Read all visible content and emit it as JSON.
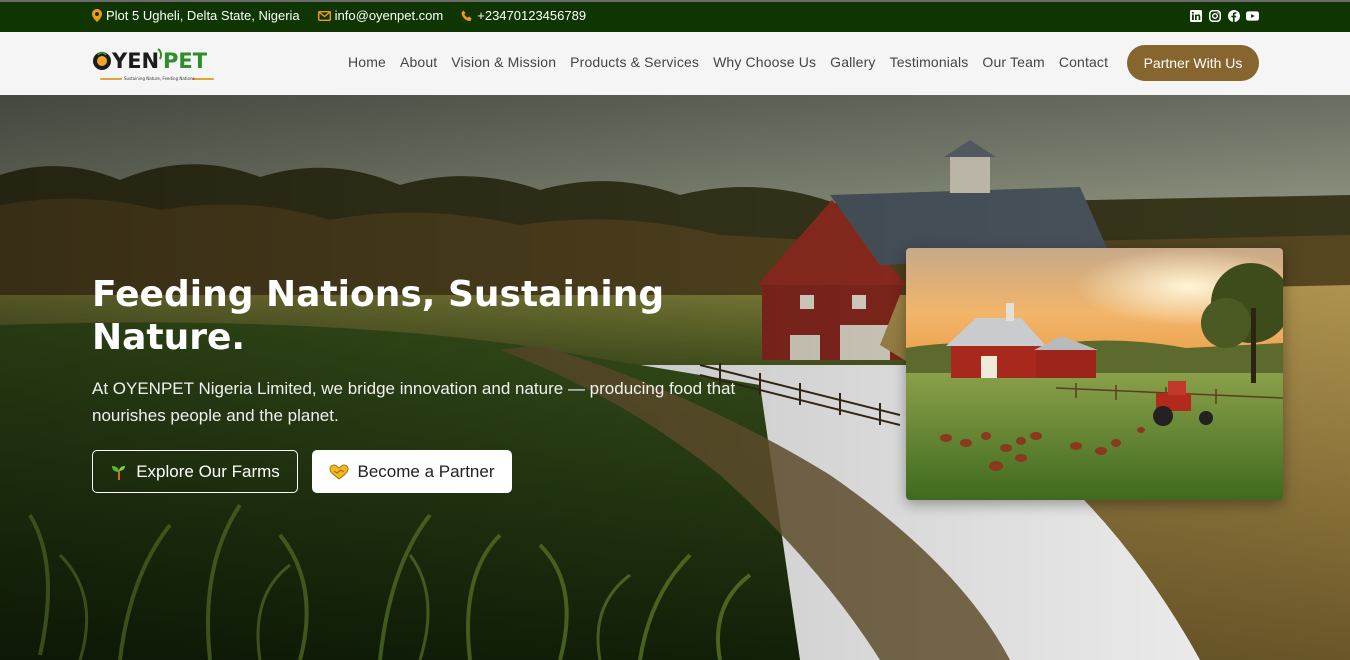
{
  "topbar": {
    "address": "Plot 5 Ugheli, Delta State, Nigeria",
    "email": "info@oyenpet.com",
    "phone": "+23470123456789",
    "social": [
      "linkedin-icon",
      "instagram-icon",
      "facebook-icon",
      "youtube-icon"
    ]
  },
  "header": {
    "logo_text": "OYENPET",
    "logo_tagline": "Sustaining Nature, Feeding Nations",
    "nav": [
      "Home",
      "About",
      "Vision & Mission",
      "Products & Services",
      "Why Choose Us",
      "Gallery",
      "Testimonials",
      "Our Team",
      "Contact"
    ],
    "cta": "Partner With Us"
  },
  "hero": {
    "title": "Feeding Nations, Sustaining Nature.",
    "subtitle": "At OYENPET Nigeria Limited, we bridge innovation and nature — producing food that nourishes people and the planet.",
    "explore_label": "Explore Our Farms",
    "partner_label": "Become a Partner"
  },
  "colors": {
    "topbar_bg": "#0f3503",
    "accent_orange": "#f39c12",
    "cta_brown": "#86652f",
    "logo_green": "#2f8d2c"
  }
}
